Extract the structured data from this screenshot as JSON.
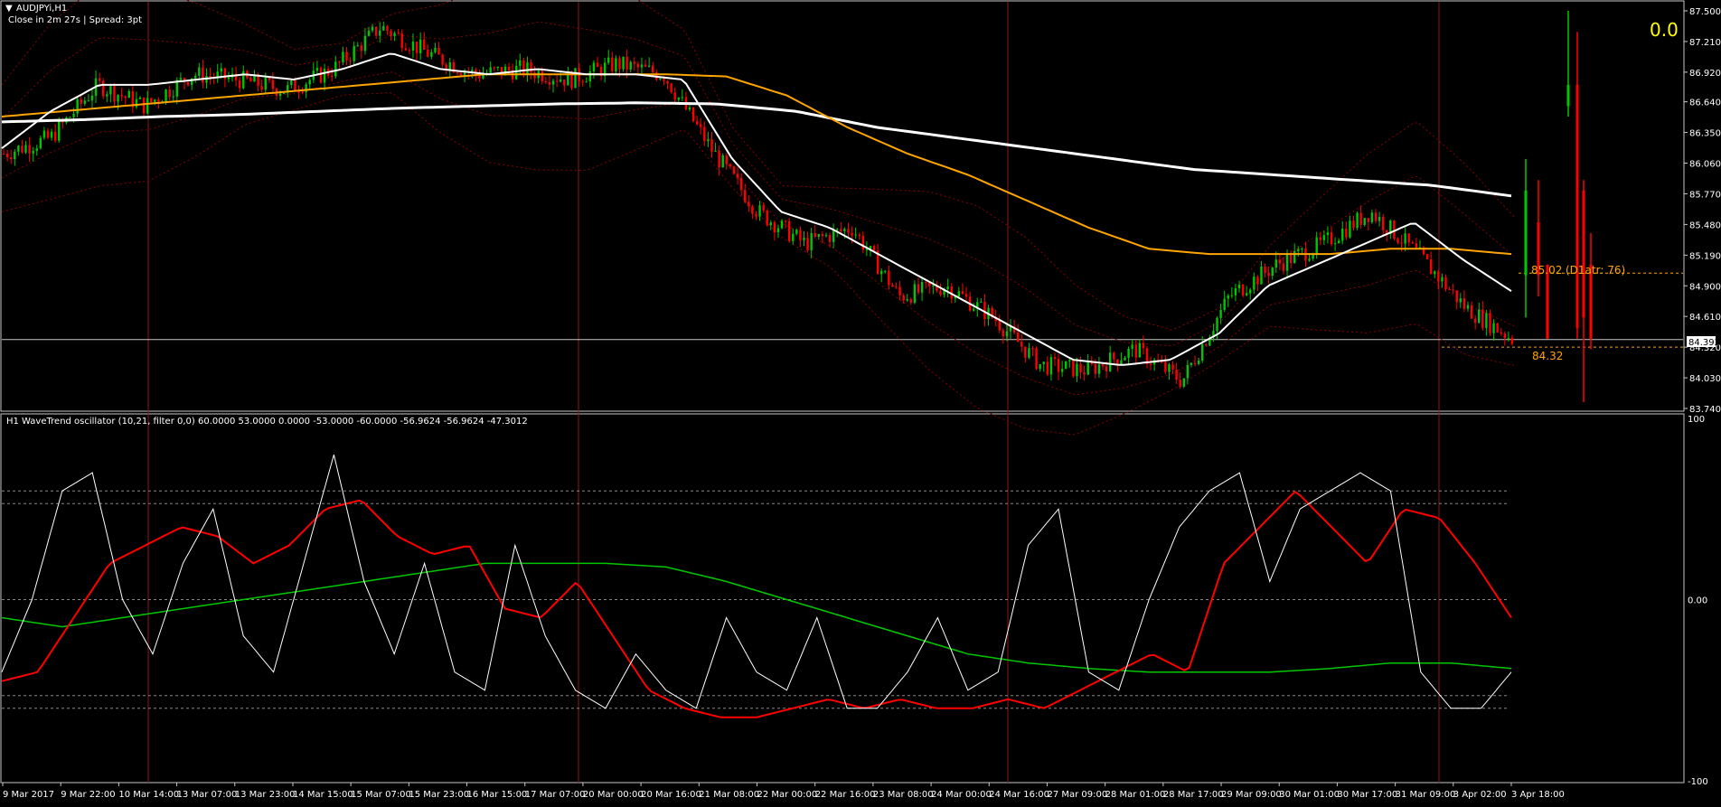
{
  "header": {
    "symbol": "AUDJPYi,H1",
    "info": "Close in 2m 27s | Spread: 3pt",
    "big_value": "0.0"
  },
  "indicator_title": "H1 WaveTrend oscillator (10,21, filter 0,0) 60.0000 53.0000 0.0000 -53.0000 -60.0000 -56.9624 -56.9624 -47.3012",
  "colors": {
    "background": "#000000",
    "bull_candle": "#00c800",
    "bear_candle": "#ff0000",
    "ma_fast": "#ffffff",
    "ma_slow": "#ffffff",
    "ma_mid": "#ffa500",
    "band": "#8b0000",
    "separator": "#8b1a1a",
    "wt_signal": "#ff0000",
    "wt_slow": "#00c800",
    "wt_fast": "#ffffff",
    "annotation": "#ffa500",
    "big_value": "#ffff00"
  },
  "price_axis": {
    "ticks": [
      "87.500",
      "87.210",
      "86.920",
      "86.640",
      "86.350",
      "86.060",
      "85.770",
      "85.480",
      "85.190",
      "84.900",
      "84.610",
      "84.320",
      "84.030",
      "83.740"
    ],
    "current_price_label": "84.392",
    "current_price": 84.392
  },
  "osc_axis": {
    "ticks": [
      "100",
      "0.00",
      "-100"
    ]
  },
  "time_axis": {
    "labels": [
      "9 Mar 2017",
      "9 Mar 22:00",
      "10 Mar 14:00",
      "13 Mar 07:00",
      "13 Mar 23:00",
      "14 Mar 15:00",
      "15 Mar 07:00",
      "15 Mar 23:00",
      "16 Mar 15:00",
      "17 Mar 07:00",
      "20 Mar 00:00",
      "20 Mar 16:00",
      "21 Mar 08:00",
      "22 Mar 00:00",
      "22 Mar 16:00",
      "23 Mar 08:00",
      "24 Mar 00:00",
      "24 Mar 16:00",
      "27 Mar 09:00",
      "28 Mar 01:00",
      "28 Mar 17:00",
      "29 Mar 09:00",
      "30 Mar 01:00",
      "30 Mar 17:00",
      "31 Mar 09:00",
      "3 Apr 02:00",
      "3 Apr 18:00"
    ]
  },
  "annotations": {
    "level_high": "85.02",
    "atr": "(D1atr: 76)",
    "level_low": "84.32",
    "level_high_value": 85.02,
    "level_low_value": 84.32
  },
  "chart_data": [
    {
      "type": "candlestick",
      "title": "AUDJPYi,H1",
      "ylim": [
        83.74,
        87.5
      ],
      "x_labels": [
        "9 Mar 2017",
        "9 Mar 22:00",
        "10 Mar 14:00",
        "13 Mar 07:00",
        "13 Mar 23:00",
        "14 Mar 15:00",
        "15 Mar 07:00",
        "15 Mar 23:00",
        "16 Mar 15:00",
        "17 Mar 07:00",
        "20 Mar 00:00",
        "20 Mar 16:00",
        "21 Mar 08:00",
        "22 Mar 00:00",
        "22 Mar 16:00",
        "23 Mar 08:00",
        "24 Mar 00:00",
        "24 Mar 16:00",
        "27 Mar 09:00",
        "28 Mar 01:00",
        "28 Mar 17:00",
        "29 Mar 09:00",
        "30 Mar 01:00",
        "30 Mar 17:00",
        "31 Mar 09:00",
        "3 Apr 02:00",
        "3 Apr 18:00"
      ],
      "close_path": [
        86.15,
        86.3,
        86.8,
        86.6,
        86.9,
        86.85,
        86.75,
        86.95,
        87.35,
        87.1,
        86.9,
        86.95,
        86.85,
        87.0,
        86.9,
        86.2,
        85.6,
        85.3,
        85.45,
        84.8,
        84.9,
        84.6,
        84.15,
        84.1,
        84.3,
        84.0,
        84.8,
        85.1,
        85.3,
        85.6,
        85.2,
        84.7,
        84.4
      ],
      "series": [
        {
          "name": "MA fast",
          "values": [
            86.2,
            86.55,
            86.8,
            86.8,
            86.85,
            86.9,
            86.85,
            86.95,
            87.1,
            86.95,
            86.9,
            86.95,
            86.9,
            86.9,
            86.85,
            86.1,
            85.6,
            85.45,
            85.2,
            84.95,
            84.7,
            84.45,
            84.2,
            84.15,
            84.2,
            84.45,
            84.9,
            85.1,
            85.3,
            85.5,
            85.15,
            84.85
          ]
        },
        {
          "name": "MA mid",
          "values": [
            86.5,
            86.55,
            86.6,
            86.65,
            86.7,
            86.75,
            86.8,
            86.85,
            86.9,
            86.9,
            86.9,
            86.9,
            86.88,
            86.7,
            86.4,
            86.15,
            85.95,
            85.7,
            85.45,
            85.25,
            85.2,
            85.2,
            85.2,
            85.25,
            85.25,
            85.2
          ]
        },
        {
          "name": "MA slow",
          "values": [
            86.45,
            86.47,
            86.5,
            86.52,
            86.55,
            86.58,
            86.6,
            86.62,
            86.63,
            86.62,
            86.55,
            86.4,
            86.3,
            86.2,
            86.1,
            86.0,
            85.95,
            85.9,
            85.85,
            85.75
          ]
        }
      ]
    },
    {
      "type": "line",
      "title": "H1 WaveTrend oscillator (10,21, filter 0,0)",
      "ylim": [
        -100,
        100
      ],
      "levels": [
        60,
        53,
        0,
        -53,
        -60
      ],
      "series": [
        {
          "name": "wt1",
          "values": [
            -40,
            0,
            60,
            70,
            0,
            -30,
            20,
            50,
            -20,
            -40,
            20,
            80,
            10,
            -30,
            20,
            -40,
            -50,
            30,
            -20,
            -50,
            -60,
            -30,
            -50,
            -60,
            -10,
            -40,
            -50,
            -10,
            -60,
            -60,
            -40,
            -10,
            -50,
            -40,
            30,
            50,
            -40,
            -50,
            0,
            40,
            60,
            70,
            10,
            50,
            60,
            70,
            60,
            -40,
            -60,
            -60,
            -40
          ]
        },
        {
          "name": "wt2",
          "values": [
            -45,
            -40,
            -10,
            20,
            30,
            40,
            35,
            20,
            30,
            50,
            55,
            35,
            25,
            30,
            -5,
            -10,
            10,
            -20,
            -50,
            -60,
            -65,
            -65,
            -60,
            -55,
            -60,
            -55,
            -60,
            -60,
            -55,
            -60,
            -50,
            -40,
            -30,
            -40,
            20,
            40,
            60,
            40,
            20,
            50,
            45,
            20,
            -10
          ]
        },
        {
          "name": "wt3",
          "values": [
            -10,
            -15,
            -10,
            -5,
            0,
            5,
            10,
            15,
            20,
            20,
            20,
            18,
            10,
            0,
            -10,
            -20,
            -30,
            -35,
            -38,
            -40,
            -40,
            -40,
            -38,
            -35,
            -35,
            -38
          ]
        }
      ]
    }
  ]
}
